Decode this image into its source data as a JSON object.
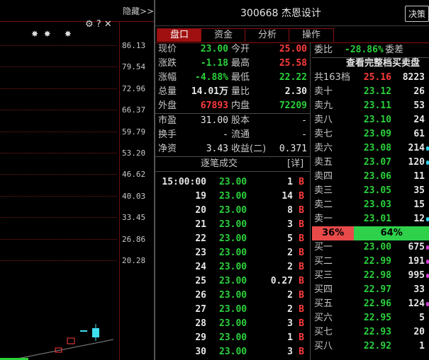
{
  "chart": {
    "hide_label": "隐藏>>",
    "price_labels": [
      "86.13",
      "79.54",
      "72.96",
      "66.37",
      "59.79",
      "53.20",
      "46.62",
      "40.03",
      "33.45",
      "26.86",
      "20.28"
    ]
  },
  "header": {
    "title": "300668 杰恩设计",
    "decide_label": "决策"
  },
  "tabs": [
    "盘口",
    "资金",
    "分析",
    "操作"
  ],
  "quote": {
    "rows": [
      {
        "l1": "现价",
        "v1": "23.00",
        "c1": "green",
        "l2": "今开",
        "v2": "25.00",
        "c2": "red"
      },
      {
        "l1": "涨跌",
        "v1": "-1.18",
        "c1": "green",
        "l2": "最高",
        "v2": "25.58",
        "c2": "red"
      },
      {
        "l1": "涨幅",
        "v1": "-4.88%",
        "c1": "green",
        "l2": "最低",
        "v2": "22.22",
        "c2": "green"
      },
      {
        "l1": "总量",
        "v1": "14.01万",
        "c1": "white",
        "l2": "量比",
        "v2": "2.30",
        "c2": "white"
      },
      {
        "l1": "外盘",
        "v1": "67893",
        "c1": "red",
        "l2": "内盘",
        "v2": "72209",
        "c2": "green"
      }
    ],
    "rows2": [
      {
        "l1": "市盈",
        "v1": "31.00",
        "l2": "股本",
        "v2": "-"
      },
      {
        "l1": "换手",
        "v1": "-",
        "l2": "流通",
        "v2": "-"
      },
      {
        "l1": "净资",
        "v1": "3.43",
        "l2": "收益(二)",
        "v2": "0.371"
      }
    ]
  },
  "ticks": {
    "title": "逐笔成交",
    "detail": "[详]",
    "rows": [
      {
        "t": "15:00:00",
        "p": "23.00",
        "v": "1",
        "d": "B"
      },
      {
        "t": "19",
        "p": "23.00",
        "v": "14",
        "d": "B"
      },
      {
        "t": "20",
        "p": "23.00",
        "v": "8",
        "d": "B"
      },
      {
        "t": "21",
        "p": "23.00",
        "v": "3",
        "d": "B"
      },
      {
        "t": "22",
        "p": "23.00",
        "v": "5",
        "d": "B"
      },
      {
        "t": "23",
        "p": "23.00",
        "v": "2",
        "d": "B"
      },
      {
        "t": "24",
        "p": "23.00",
        "v": "2",
        "d": "B"
      },
      {
        "t": "25",
        "p": "23.00",
        "v": "0.27",
        "d": "B"
      },
      {
        "t": "26",
        "p": "23.00",
        "v": "2",
        "d": "B"
      },
      {
        "t": "27",
        "p": "23.00",
        "v": "2",
        "d": "B"
      },
      {
        "t": "28",
        "p": "23.00",
        "v": "3",
        "d": "B"
      },
      {
        "t": "29",
        "p": "23.00",
        "v": "1",
        "d": "B"
      },
      {
        "t": "30",
        "p": "23.00",
        "v": "3",
        "d": "B"
      }
    ]
  },
  "orderbook": {
    "weibi_label": "委比",
    "weibi_value": "-28.86%",
    "weicha_label": "委差",
    "full_label": "查看完整档买卖盘",
    "total": {
      "label": "共163档",
      "price": "25.16",
      "vol": "8223"
    },
    "asks": [
      {
        "l": "卖十",
        "p": "23.12",
        "v": "26"
      },
      {
        "l": "卖九",
        "p": "23.11",
        "v": "53"
      },
      {
        "l": "卖八",
        "p": "23.10",
        "v": "24"
      },
      {
        "l": "卖七",
        "p": "23.09",
        "v": "61"
      },
      {
        "l": "卖六",
        "p": "23.08",
        "v": "214"
      },
      {
        "l": "卖五",
        "p": "23.07",
        "v": "120"
      },
      {
        "l": "卖四",
        "p": "23.06",
        "v": "11"
      },
      {
        "l": "卖三",
        "p": "23.05",
        "v": "35"
      },
      {
        "l": "卖二",
        "p": "23.03",
        "v": "15"
      },
      {
        "l": "卖一",
        "p": "23.01",
        "v": "12"
      }
    ],
    "bar": {
      "left": "36%",
      "right": "64%",
      "left_fraction": 0.36
    },
    "bids": [
      {
        "l": "买一",
        "p": "23.00",
        "v": "675"
      },
      {
        "l": "买二",
        "p": "22.99",
        "v": "191"
      },
      {
        "l": "买三",
        "p": "22.98",
        "v": "995"
      },
      {
        "l": "买四",
        "p": "22.97",
        "v": "33"
      },
      {
        "l": "买五",
        "p": "22.96",
        "v": "124"
      },
      {
        "l": "买六",
        "p": "22.95",
        "v": "5"
      },
      {
        "l": "买七",
        "p": "22.93",
        "v": "20"
      },
      {
        "l": "买八",
        "p": "22.92",
        "v": "1"
      }
    ]
  },
  "colors": {
    "red": "#ff3b3b",
    "green": "#2bd13b",
    "bar_red": "#e84a4a",
    "bar_green": "#2fd14a"
  }
}
